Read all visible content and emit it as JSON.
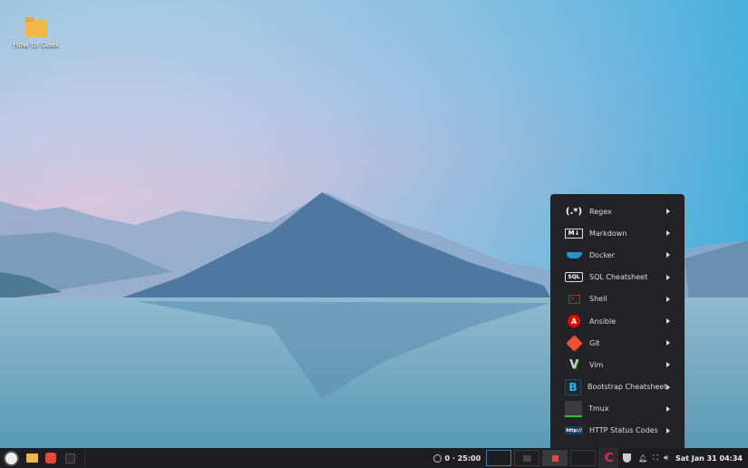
{
  "desktop": {
    "icons": [
      {
        "label": "How to Geek",
        "icon": "folder-icon"
      }
    ]
  },
  "menu": {
    "items": [
      {
        "label": "Regex",
        "icon": "regex-icon"
      },
      {
        "label": "Markdown",
        "icon": "markdown-icon"
      },
      {
        "label": "Docker",
        "icon": "docker-icon"
      },
      {
        "label": "SQL Cheatsheet",
        "icon": "sql-icon"
      },
      {
        "label": "Shell",
        "icon": "shell-icon"
      },
      {
        "label": "Ansible",
        "icon": "ansible-icon"
      },
      {
        "label": "Git",
        "icon": "git-icon"
      },
      {
        "label": "Vim",
        "icon": "vim-icon"
      },
      {
        "label": "Bootstrap Cheatsheet",
        "icon": "bootstrap-icon"
      },
      {
        "label": "Tmux",
        "icon": "tmux-icon"
      },
      {
        "label": "HTTP Status Codes",
        "icon": "http-icon"
      }
    ]
  },
  "icon_text": {
    "regex": "(.*)",
    "markdown": "M↓",
    "sql": "SQL",
    "shell": ">_",
    "ansible": "A",
    "bootstrap": "B",
    "http": "http://",
    "vim": "V",
    "cheat": "C"
  },
  "taskbar": {
    "timer": "0 · 25:00",
    "clock": "Sat Jan 31 04:34"
  }
}
